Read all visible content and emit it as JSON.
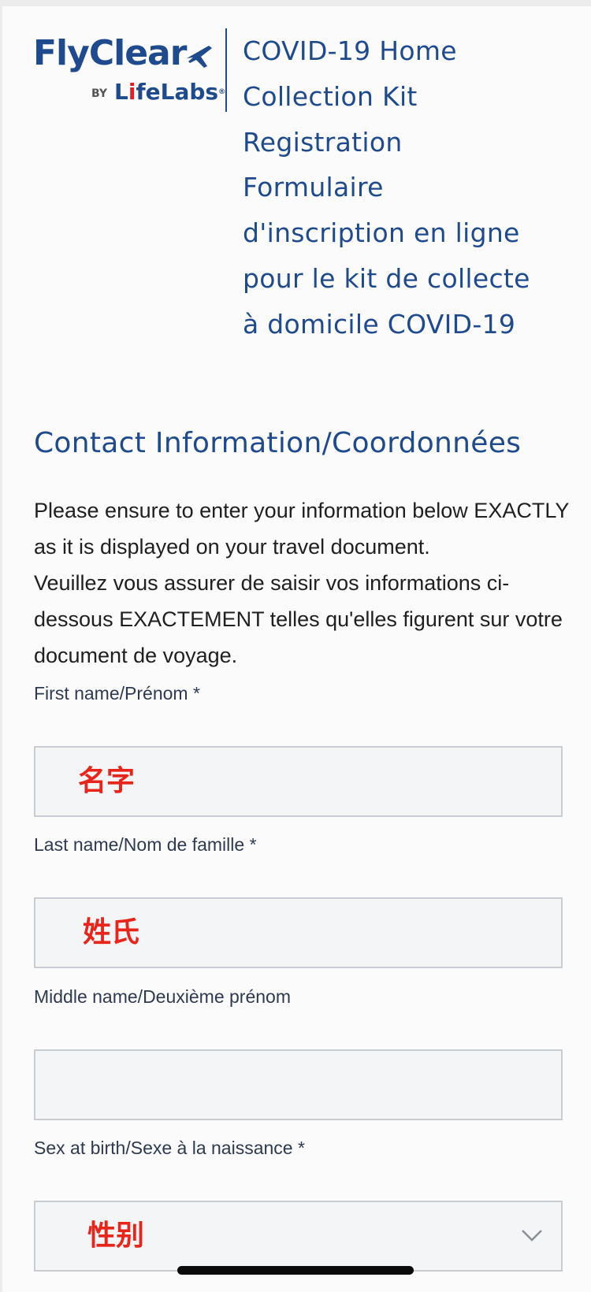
{
  "header": {
    "logo": {
      "brand": "FlyClear",
      "by": "BY",
      "sub_prefix": "L",
      "sub_accent": "i",
      "sub_rest": "feLabs",
      "registered": "®"
    },
    "title_lines": [
      "COVID-19 Home",
      "Collection Kit",
      "Registration",
      "Formulaire",
      "d'inscription en ligne",
      "pour le kit de collecte",
      "à domicile COVID-19"
    ]
  },
  "section": {
    "title": "Contact Information/Coordonnées",
    "instructions_en": "Please ensure to enter your information below EXACTLY as it is displayed on your travel document.",
    "instructions_fr": "Veuillez vous assurer de saisir vos informations ci-dessous EXACTEMENT telles qu'elles figurent sur votre document de voyage."
  },
  "form": {
    "first_name": {
      "label": "First name/Prénom *",
      "value": "名字"
    },
    "last_name": {
      "label": "Last name/Nom de famille *",
      "value": "姓氏"
    },
    "middle_name": {
      "label": "Middle name/Deuxième prénom",
      "value": ""
    },
    "sex_at_birth": {
      "label": "Sex at birth/Sexe à la naissance *",
      "value": "性别",
      "icon": "chevron-down-icon"
    }
  },
  "colors": {
    "brand_blue": "#1f4a8d",
    "annotation_red": "#e8241b",
    "logo_red": "#e01f26",
    "field_border": "#c9ccd1",
    "field_bg": "#f4f5f6"
  }
}
